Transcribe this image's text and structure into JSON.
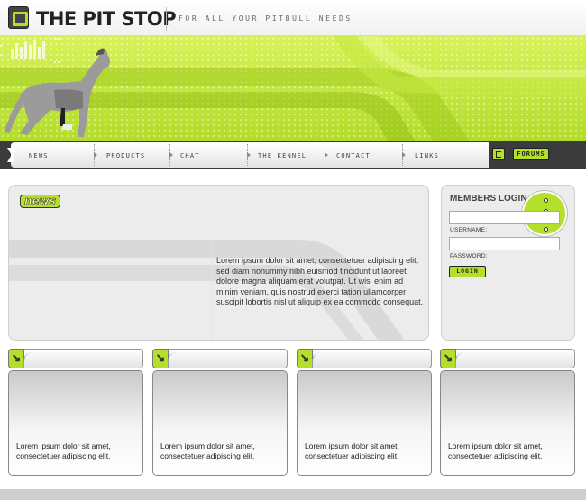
{
  "header": {
    "logo_text": "THE PIT STOP",
    "tagline": "FOR ALL YOUR PITBULL NEEDS"
  },
  "nav": {
    "items": [
      "NEWS",
      "PRODUCTS",
      "CHAT",
      "THE KENNEL",
      "CONTACT",
      "LINKS"
    ],
    "forums_label": "FORUMS"
  },
  "news": {
    "title": "news",
    "body": "Lorem ipsum dolor sit amet, consectetuer adipiscing elit, sed diam nonummy nibh euismod tincidunt ut laoreet dolore magna aliquam erat volutpat. Ut wisi enim ad minim veniam, quis nostrud exerci tation ullamcorper suscipit lobortis nisl ut aliquip ex ea commodo consequat."
  },
  "login": {
    "title": "MEMBERS LOGIN",
    "username_label": "USERNAME:",
    "password_label": "PASSWORD:",
    "button_label": "LOGIN",
    "username_value": "",
    "password_value": ""
  },
  "boxes": [
    {
      "text": "Lorem ipsum dolor sit amet, consectetuer adipiscing elit."
    },
    {
      "text": "Lorem ipsum dolor sit amet, consectetuer adipiscing elit."
    },
    {
      "text": "Lorem ipsum dolor sit amet, consectetuer adipiscing elit."
    },
    {
      "text": "Lorem ipsum dolor sit amet, consectetuer adipiscing elit."
    }
  ],
  "colors": {
    "accent": "#b4e02c",
    "nav_bg": "#3b3b3b",
    "panel_bg": "#ececec"
  }
}
